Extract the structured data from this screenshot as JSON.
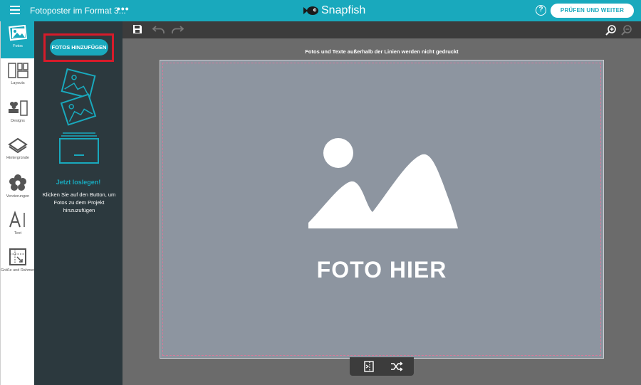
{
  "header": {
    "doc_title": "Fotoposter im Format 3...",
    "more": "•••",
    "logo": "Snapfish",
    "help": "?",
    "review_button": "PRÜFEN UND WEITER"
  },
  "sidebar": {
    "items": [
      {
        "label": "Fotos",
        "icon": "photos-icon",
        "active": true
      },
      {
        "label": "Layouts",
        "icon": "layouts-icon"
      },
      {
        "label": "Designs",
        "icon": "designs-icon"
      },
      {
        "label": "Hintergründe",
        "icon": "backgrounds-icon"
      },
      {
        "label": "Verzierungen",
        "icon": "embellishments-icon"
      },
      {
        "label": "Text",
        "icon": "text-icon"
      },
      {
        "label": "Größe und Rahmen",
        "icon": "size-frame-icon"
      }
    ]
  },
  "panel": {
    "add_photos_button": "FOTOS HINZUFÜGEN",
    "get_started": "Jetzt loslegen!",
    "instruction": "Klicken Sie auf den Button, um Fotos zu dem Projekt hinzuzufügen"
  },
  "canvas": {
    "notice": "Fotos und Texte außerhalb der Linien werden nicht gedruckt",
    "placeholder_text": "FOTO HIER"
  },
  "colors": {
    "accent": "#19a9bd",
    "panel": "#2c393e",
    "highlight": "#d71b2a"
  }
}
